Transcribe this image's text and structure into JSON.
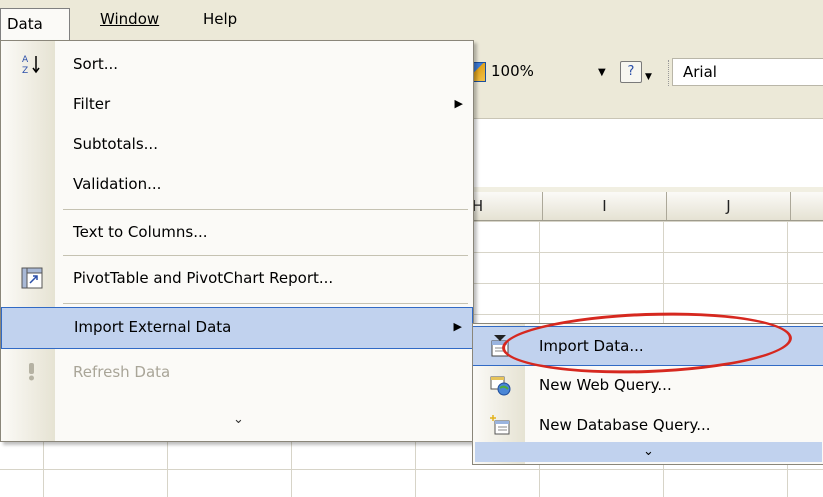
{
  "menubar": {
    "data": "Data",
    "window": "Window",
    "help": "Help"
  },
  "toolbar": {
    "zoom": "100%",
    "help_glyph": "?",
    "font": "Arial"
  },
  "columns": [
    {
      "label": "H"
    },
    {
      "label": "I"
    },
    {
      "label": "J"
    }
  ],
  "data_menu": {
    "items": [
      {
        "label": "Sort...",
        "icon": "sort-az-icon"
      },
      {
        "label": "Filter",
        "submenu_arrow": "▶"
      },
      {
        "label": "Subtotals..."
      },
      {
        "label": "Validation..."
      },
      {
        "label": "Text to Columns..."
      },
      {
        "label": "PivotTable and PivotChart Report...",
        "icon": "pivottable-icon"
      },
      {
        "label": "Import External Data",
        "submenu_arrow": "▶",
        "highlighted": true
      },
      {
        "label": "Refresh Data",
        "icon": "refresh-exclamation-icon",
        "disabled": true
      }
    ],
    "expand_glyph": "⌄"
  },
  "import_submenu": {
    "items": [
      {
        "label": "Import Data...",
        "icon": "import-data-icon",
        "highlighted": true
      },
      {
        "label": "New Web Query...",
        "icon": "web-query-icon"
      },
      {
        "label": "New Database Query...",
        "icon": "database-query-icon"
      }
    ],
    "expand_glyph": "⌄"
  },
  "colors": {
    "highlight_fill": "#c1d2ee",
    "highlight_border": "#316ac5",
    "annotation_red": "#d6281f"
  }
}
